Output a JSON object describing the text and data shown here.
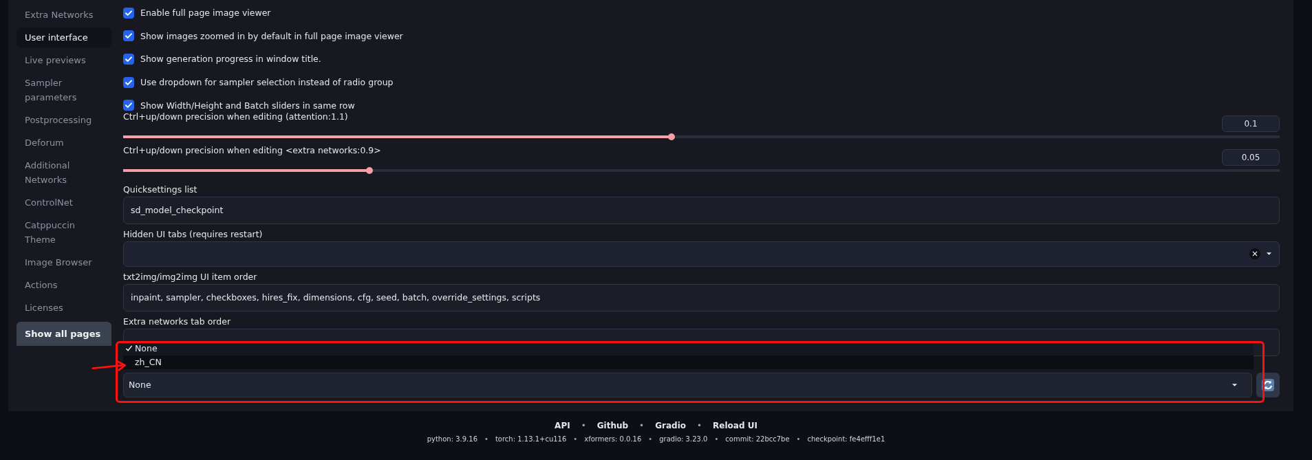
{
  "sidebar": {
    "items": [
      {
        "label": "Extra Networks",
        "selected": false
      },
      {
        "label": "User interface",
        "selected": true
      },
      {
        "label": "Live previews",
        "selected": false
      },
      {
        "label": "Sampler parameters",
        "selected": false
      },
      {
        "label": "Postprocessing",
        "selected": false
      },
      {
        "label": "Deforum",
        "selected": false
      },
      {
        "label": "Additional Networks",
        "selected": false
      },
      {
        "label": "ControlNet",
        "selected": false
      },
      {
        "label": "Catppuccin Theme",
        "selected": false
      },
      {
        "label": "Image Browser",
        "selected": false
      },
      {
        "label": "Actions",
        "selected": false
      },
      {
        "label": "Licenses",
        "selected": false
      }
    ],
    "show_all_button": "Show all pages"
  },
  "settings": [
    {
      "kind": "checkbox",
      "label": "Enable full page image viewer",
      "checked": true
    },
    {
      "kind": "checkbox",
      "label": "Show images zoomed in by default in full page image viewer",
      "checked": true
    },
    {
      "kind": "checkbox",
      "label": "Show generation progress in window title.",
      "checked": true
    },
    {
      "kind": "checkbox",
      "label": "Use dropdown for sampler selection instead of radio group",
      "checked": true
    },
    {
      "kind": "checkbox",
      "label": "Show Width/Height and Batch sliders in same row",
      "checked": true
    },
    {
      "kind": "slider",
      "label": "Ctrl+up/down precision when editing (attention:1.1)",
      "value": "0.1",
      "level": 0.474
    },
    {
      "kind": "slider",
      "label": "Ctrl+up/down precision when editing <extra networks:0.9>",
      "value": "0.05",
      "level": 0.213
    },
    {
      "kind": "text",
      "label": "Quicksettings list",
      "value": "sd_model_checkpoint"
    },
    {
      "kind": "multiselect",
      "label": "Hidden UI tabs (requires restart)"
    },
    {
      "kind": "text",
      "label": "txt2img/img2img UI item order",
      "value": "inpaint, sampler, checkboxes, hires_fix, dimensions, cfg, seed, batch, override_settings, scripts"
    },
    {
      "kind": "text",
      "label": "Extra networks tab order"
    }
  ],
  "localization": {
    "value": "None",
    "options": [
      {
        "label": "None",
        "selected": true
      },
      {
        "label": "zh_CN",
        "selected": false
      }
    ]
  },
  "footer": {
    "links": [
      {
        "kind": "link",
        "text": "API"
      },
      {
        "kind": "separator",
        "text": "•"
      },
      {
        "kind": "link",
        "text": "Github"
      },
      {
        "kind": "separator",
        "text": "•"
      },
      {
        "kind": "link",
        "text": "Gradio"
      },
      {
        "kind": "separator",
        "text": "•"
      },
      {
        "kind": "link",
        "text": "Reload UI"
      }
    ],
    "versions": [
      {
        "kind": "info",
        "text": "python: 3.9.16"
      },
      {
        "kind": "separator",
        "text": "•"
      },
      {
        "kind": "info",
        "text": "torch: 1.13.1+cu116"
      },
      {
        "kind": "separator",
        "text": "•"
      },
      {
        "kind": "info",
        "text": "xformers: 0.0.16"
      },
      {
        "kind": "separator",
        "text": "•"
      },
      {
        "kind": "info",
        "text": "gradio: 3.23.0"
      },
      {
        "kind": "separator",
        "text": "•"
      },
      {
        "kind": "info",
        "text": "commit: 22bcc7be"
      },
      {
        "kind": "separator",
        "text": "•"
      },
      {
        "kind": "info",
        "text": "checkpoint: fe4efff1e1"
      }
    ]
  }
}
